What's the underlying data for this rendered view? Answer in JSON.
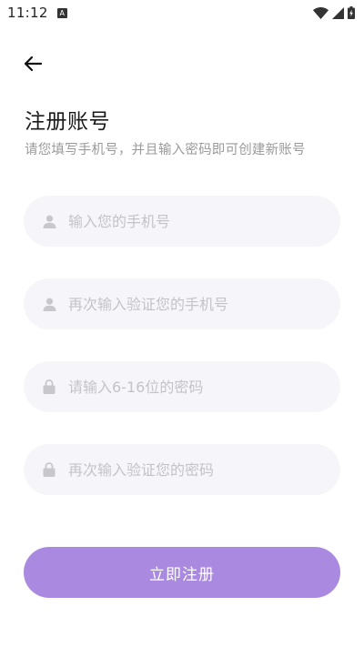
{
  "status_bar": {
    "time": "11:12",
    "notification_glyph": "A",
    "icons": [
      "wifi-icon",
      "signal-icon",
      "battery-charging-icon"
    ]
  },
  "header": {
    "back_icon": "arrow-left-icon",
    "title": "注册账号",
    "subtitle": "请您填写手机号，并且输入密码即可创建新账号"
  },
  "form": {
    "fields": [
      {
        "icon": "user-icon",
        "placeholder": "输入您的手机号",
        "value": ""
      },
      {
        "icon": "user-icon",
        "placeholder": "再次输入验证您的手机号",
        "value": ""
      },
      {
        "icon": "lock-icon",
        "placeholder": "请输入6-16位的密码",
        "value": ""
      },
      {
        "icon": "lock-icon",
        "placeholder": "再次输入验证您的密码",
        "value": ""
      }
    ],
    "submit_label": "立即注册"
  },
  "colors": {
    "accent": "#a98ae0",
    "field_bg": "#f6f6fa",
    "placeholder": "#c4c4c8",
    "subtitle": "#9a9a9a"
  }
}
